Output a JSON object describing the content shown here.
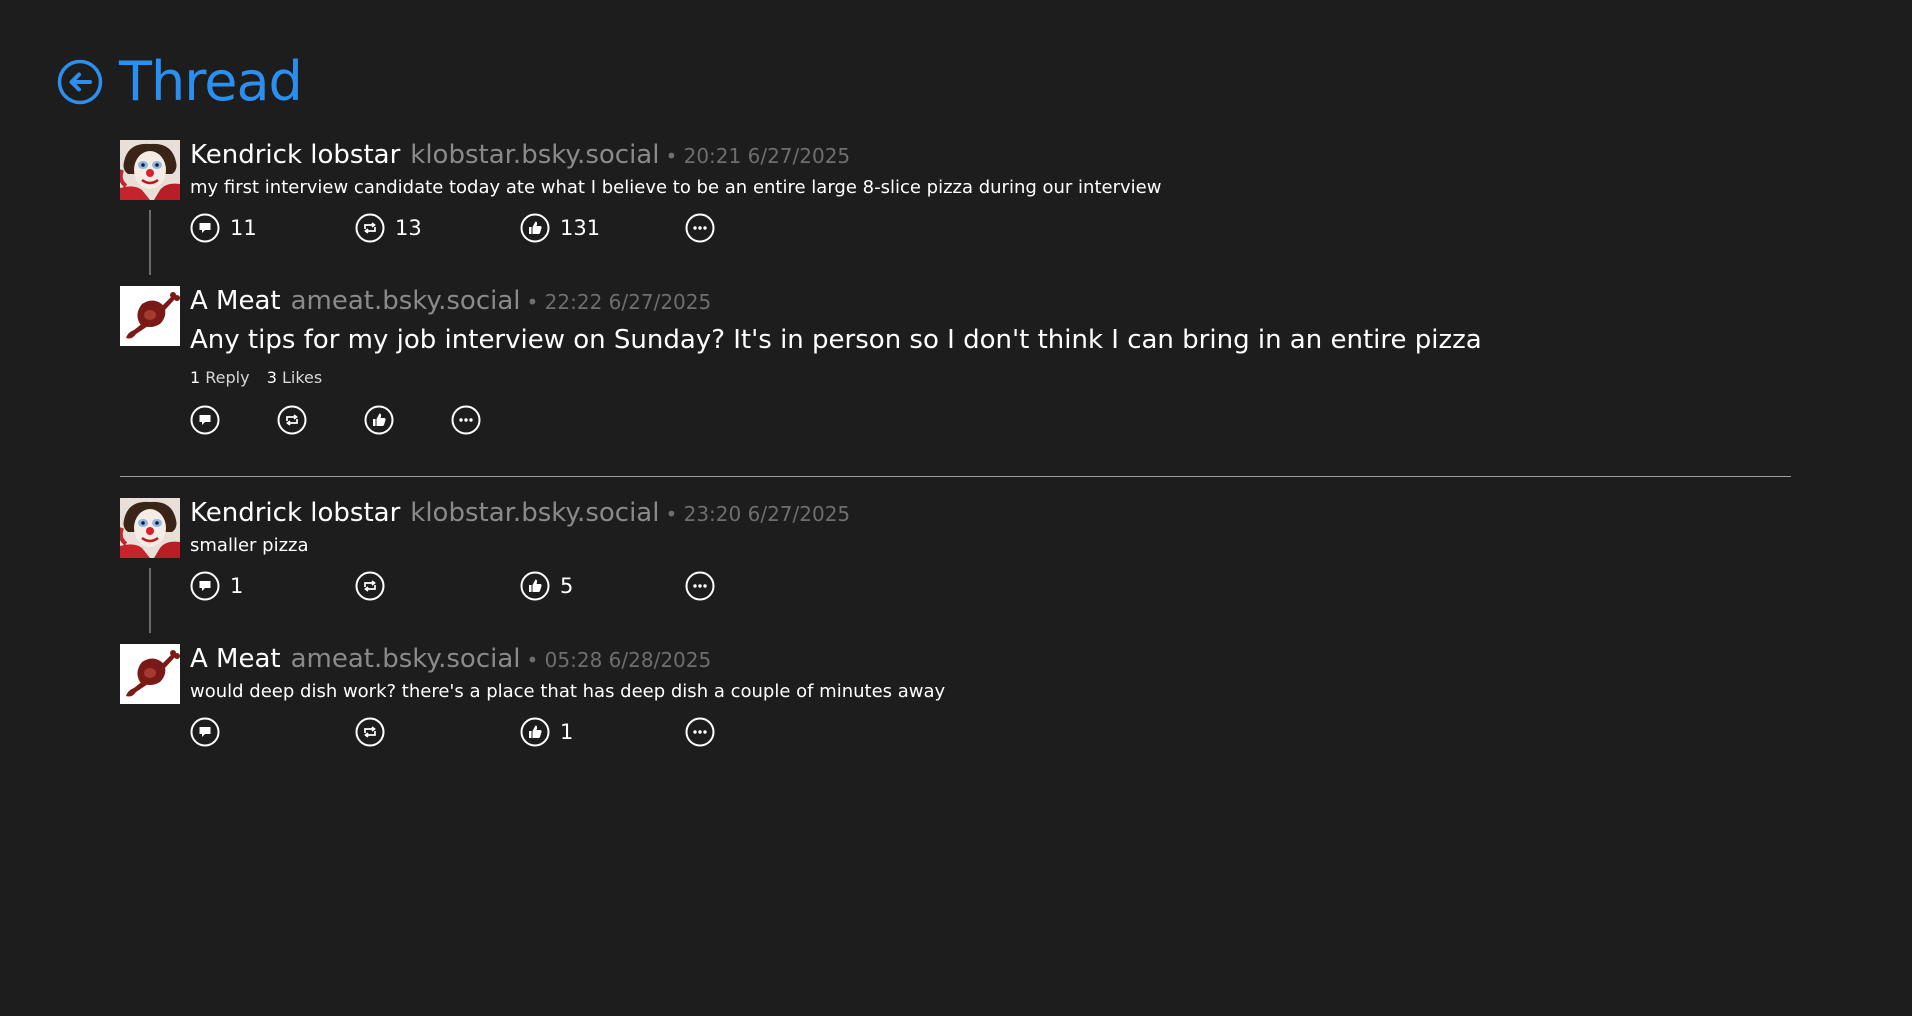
{
  "header": {
    "title": "Thread",
    "back_icon": "arrow-left-circle-icon",
    "accent": "#2b8ff0"
  },
  "threads": [
    {
      "parent": {
        "name": "Kendrick lobstar",
        "handle": "klobstar.bsky.social",
        "time": "• 20:21 6/27/2025",
        "text": "my first interview candidate today ate what I believe to be an entire large 8-slice pizza during our interview",
        "reply_count": "11",
        "repost_count": "13",
        "like_count": "131"
      },
      "focus": {
        "name": "A Meat",
        "handle": "ameat.bsky.social",
        "time": "• 22:22 6/27/2025",
        "text": "Any tips for my job interview on Sunday? It's in person so I don't think I can bring in an entire pizza",
        "stats": {
          "replies_num": "1",
          "replies_label": "Reply",
          "likes_num": "3",
          "likes_label": "Likes"
        }
      }
    },
    {
      "parent": {
        "name": "Kendrick lobstar",
        "handle": "klobstar.bsky.social",
        "time": "• 23:20 6/27/2025",
        "text": "smaller pizza",
        "reply_count": "1",
        "repost_count": "",
        "like_count": "5"
      },
      "child": {
        "name": "A Meat",
        "handle": "ameat.bsky.social",
        "time": "• 05:28 6/28/2025",
        "text": "would deep dish work? there's a place that has deep dish a couple of minutes away",
        "reply_count": "",
        "repost_count": "",
        "like_count": "1"
      }
    }
  ],
  "icons": {
    "reply": "reply-bubble-icon",
    "repost": "repost-arrows-icon",
    "like": "thumbs-up-icon",
    "more": "more-dots-icon"
  },
  "colors": {
    "background": "#1d1d1d",
    "handle": "#8a8a8a",
    "timestamp": "#6e6e6e"
  }
}
